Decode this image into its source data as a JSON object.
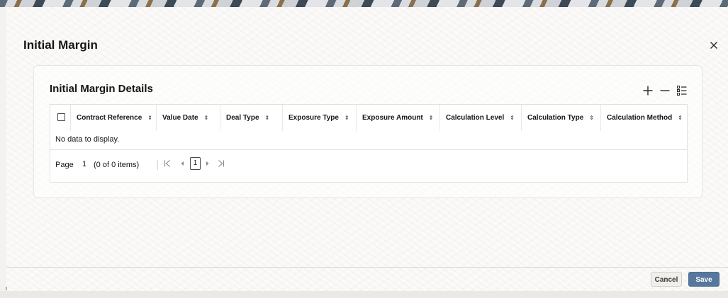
{
  "dialog": {
    "title": "Initial Margin",
    "close_icon": "close-icon"
  },
  "section": {
    "title": "Initial Margin Details",
    "toolbar": {
      "add_icon": "plus-icon",
      "remove_icon": "minus-icon",
      "columns_icon": "list-settings-icon"
    }
  },
  "grid": {
    "columns": [
      {
        "label": "Contract Reference"
      },
      {
        "label": "Value Date"
      },
      {
        "label": "Deal Type"
      },
      {
        "label": "Exposure Type"
      },
      {
        "label": "Exposure Amount"
      },
      {
        "label": "Calculation Level"
      },
      {
        "label": "Calculation Type"
      },
      {
        "label": "Calculation Method"
      }
    ],
    "empty_message": "No data to display."
  },
  "pager": {
    "page_label": "Page",
    "page_value": "1",
    "count_text": "(0 of 0 items)",
    "first_icon": "first-page-icon",
    "prev_icon": "previous-page-icon",
    "current_page": "1",
    "next_icon": "next-page-icon",
    "last_icon": "last-page-icon"
  },
  "footer": {
    "cancel_label": "Cancel",
    "save_label": "Save"
  },
  "colors": {
    "primary_button": "#56789e",
    "text": "#161513"
  }
}
